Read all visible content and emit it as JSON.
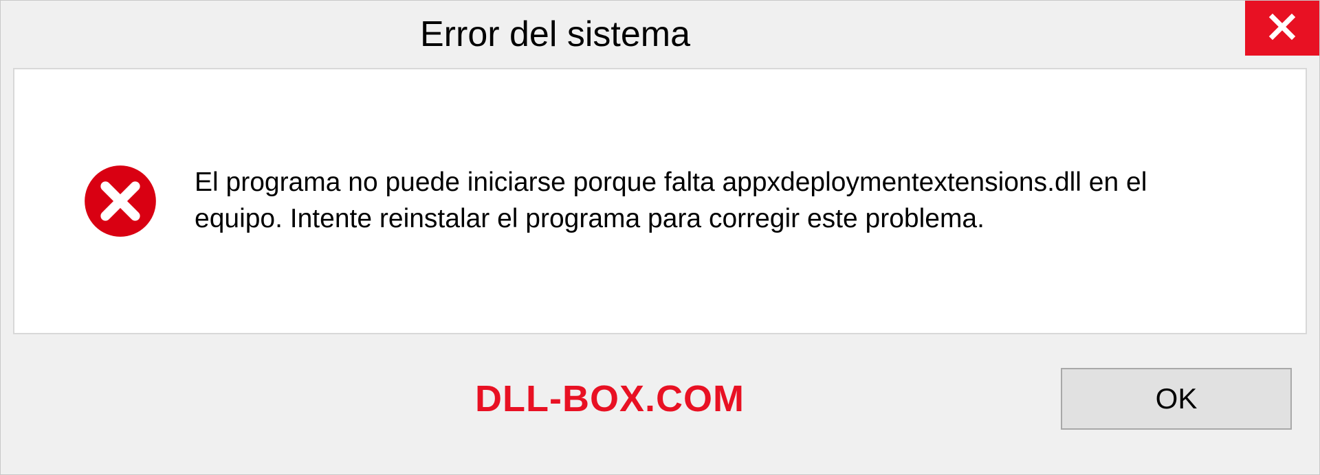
{
  "dialog": {
    "title": "Error del sistema",
    "message": "El programa no puede iniciarse porque falta appxdeploymentextensions.dll en el equipo. Intente reinstalar el programa para corregir este problema.",
    "ok_label": "OK"
  },
  "watermark": {
    "text": "DLL-BOX.COM"
  },
  "colors": {
    "close_bg": "#e81123",
    "error_icon": "#d90012"
  }
}
